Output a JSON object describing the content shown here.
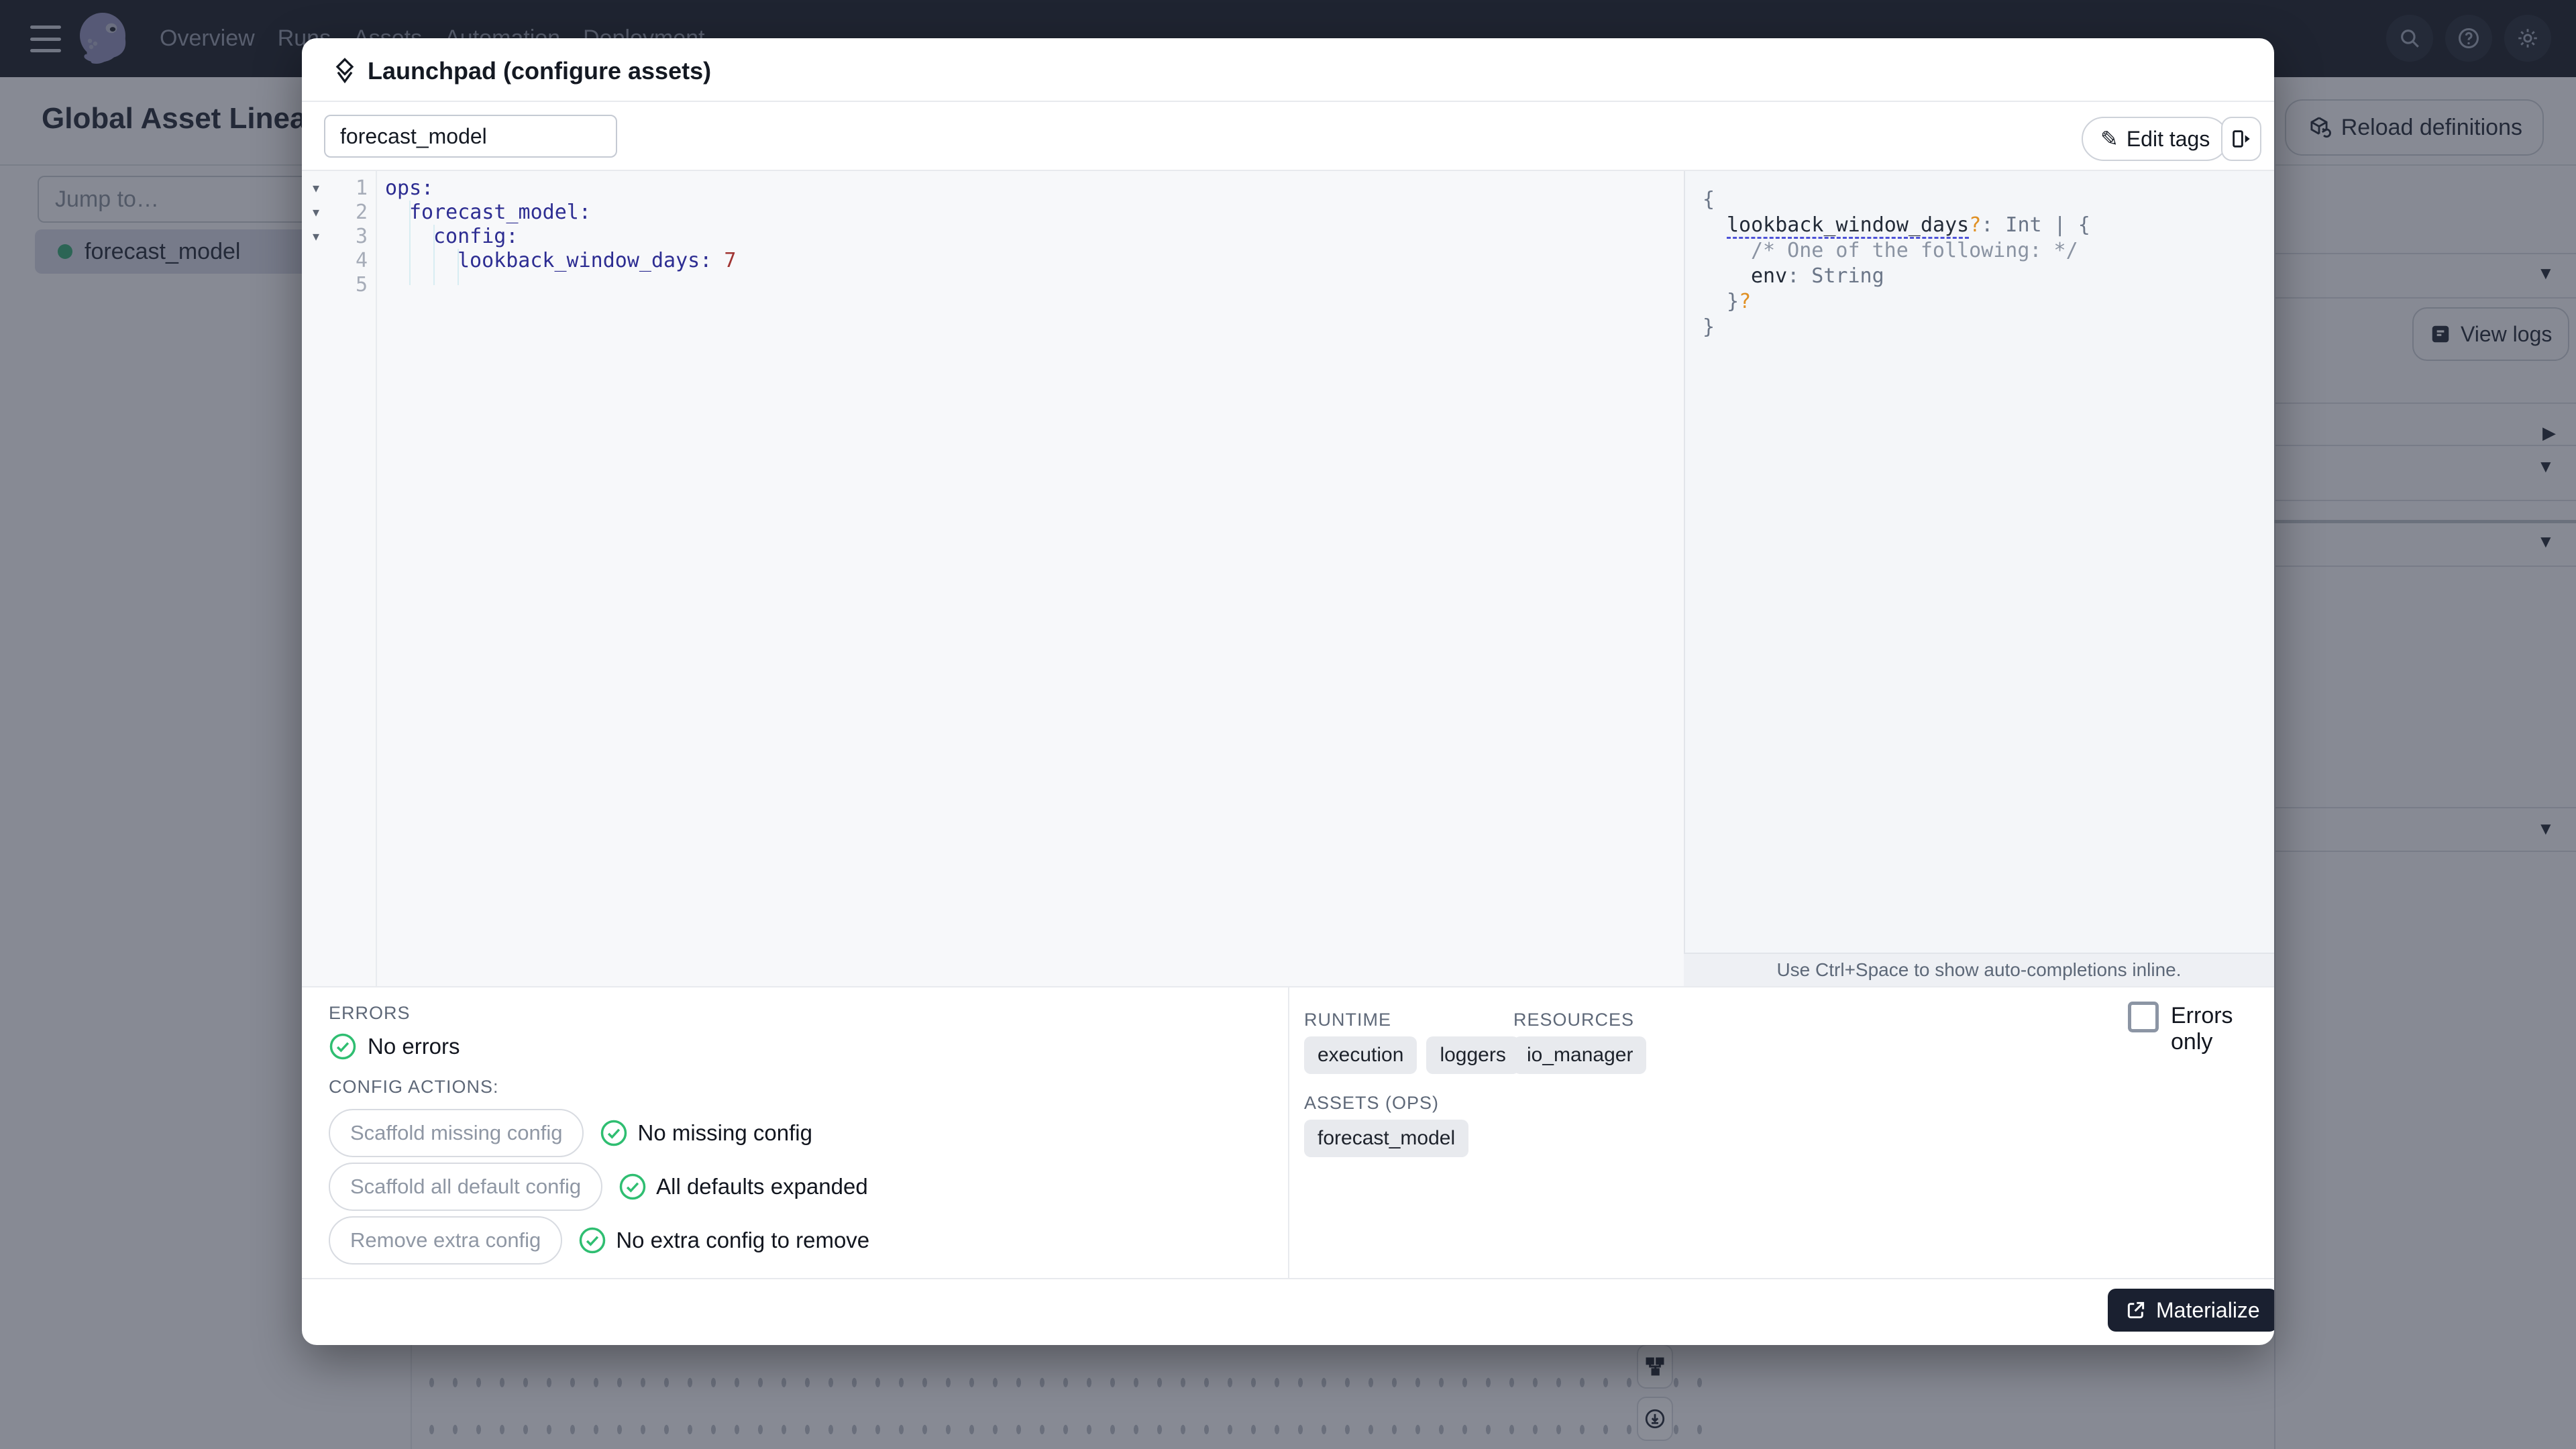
{
  "nav": {
    "items": [
      "Overview",
      "Runs",
      "Assets",
      "Automation",
      "Deployment"
    ]
  },
  "background": {
    "title": "Global Asset Lineage",
    "reload_definitions_label": "Reload definitions",
    "jump_to_placeholder": "Jump to…",
    "selected_asset": "forecast_model",
    "view_logs_label": "View logs"
  },
  "modal": {
    "title": "Launchpad (configure assets)",
    "op_selector_value": "forecast_model",
    "edit_tags_label": "Edit tags",
    "editor": {
      "line_numbers": [
        "1",
        "2",
        "3",
        "4",
        "5"
      ],
      "code": {
        "line1": "ops:",
        "line2": "forecast_model:",
        "line3": "config:",
        "line4_key": "lookback_window_days:",
        "line4_value": "7"
      }
    },
    "schema": {
      "l1": "{",
      "l2_key": "lookback_window_days",
      "l2_q": "?",
      "l2_rest": ": Int | {",
      "l3_comment": "/* One of the following: */",
      "l4_key": "env",
      "l4_rest": ": String",
      "l5_brace": "}",
      "l5_q": "?",
      "l6": "}"
    },
    "hint": "Use Ctrl+Space to show auto-completions inline.",
    "errors_heading": "ERRORS",
    "errors_status": "No errors",
    "config_actions_heading": "CONFIG ACTIONS:",
    "config_actions": [
      {
        "button": "Scaffold missing config",
        "status": "No missing config"
      },
      {
        "button": "Scaffold all default config",
        "status": "All defaults expanded"
      },
      {
        "button": "Remove extra config",
        "status": "No extra config to remove"
      }
    ],
    "runtime_heading": "RUNTIME",
    "runtime_tags": [
      "execution",
      "loggers"
    ],
    "resources_heading": "RESOURCES",
    "resources_tags": [
      "io_manager"
    ],
    "assets_ops_heading": "ASSETS (OPS)",
    "assets_ops_tags": [
      "forecast_model"
    ],
    "errors_only_label": "Errors only",
    "materialize_label": "Materialize"
  },
  "colors": {
    "success_green": "#2fbe71",
    "asset_dot_green": "#2da46f",
    "code_key_blue": "#2d2d92",
    "code_value_red": "#a03432",
    "schema_optional_orange": "#e09024",
    "materialize_bg": "#1a2030"
  }
}
